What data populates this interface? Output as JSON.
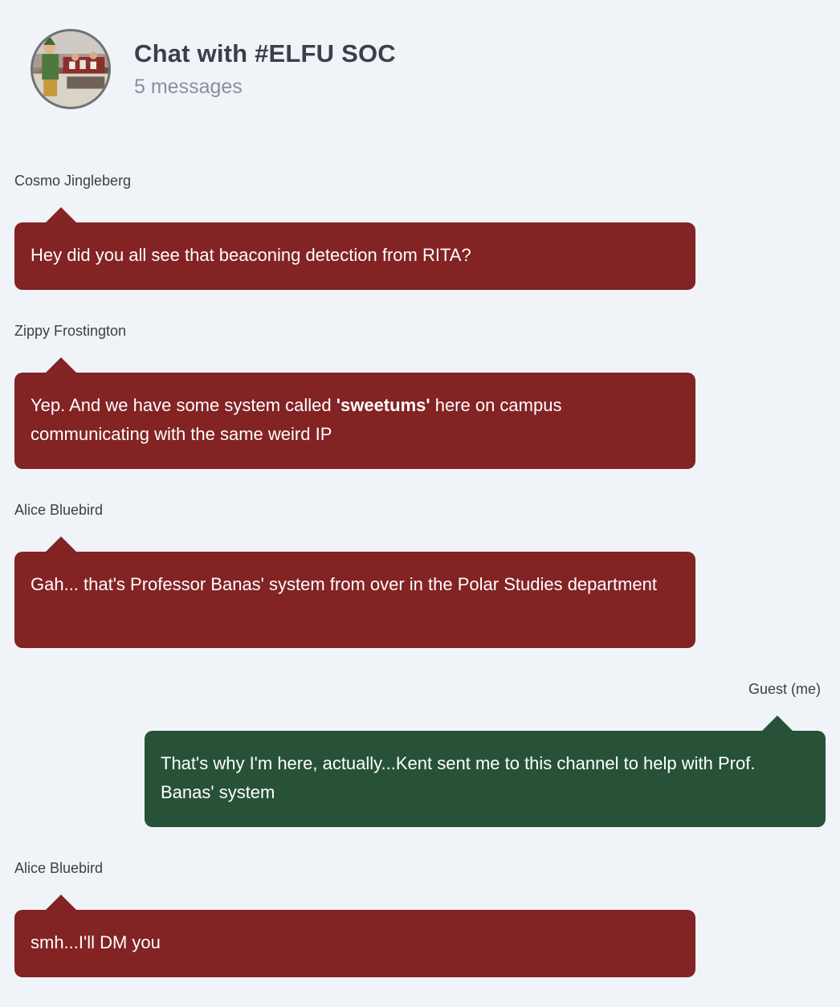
{
  "chat": {
    "title": "Chat with #ELFU SOC",
    "message_count": "5 messages"
  },
  "messages": [
    {
      "sender": "Cosmo Jingleberg",
      "text": "Hey did you all see that beaconing detection from RITA?",
      "side": "them"
    },
    {
      "sender": "Zippy Frostington",
      "text_before": "Yep. And we have some system called ",
      "text_bold": "'sweetums'",
      "text_after": " here on campus communicating with the same weird IP",
      "side": "them"
    },
    {
      "sender": "Alice Bluebird",
      "text": "Gah... that's Professor Banas' system from over in the Polar Studies department",
      "side": "them"
    },
    {
      "sender": "Guest (me)",
      "text": "That's why I'm here, actually...Kent sent me to this channel to help with Prof. Banas' system",
      "side": "me"
    },
    {
      "sender": "Alice Bluebird",
      "text": "smh...I'll DM you",
      "side": "them"
    }
  ],
  "colors": {
    "background": "#f0f4f8",
    "bubble_them": "#832324",
    "bubble_me": "#275237",
    "title": "#3b3f47",
    "subtitle": "#8a9099"
  },
  "icons": {
    "avatar": "channel-avatar-image"
  }
}
